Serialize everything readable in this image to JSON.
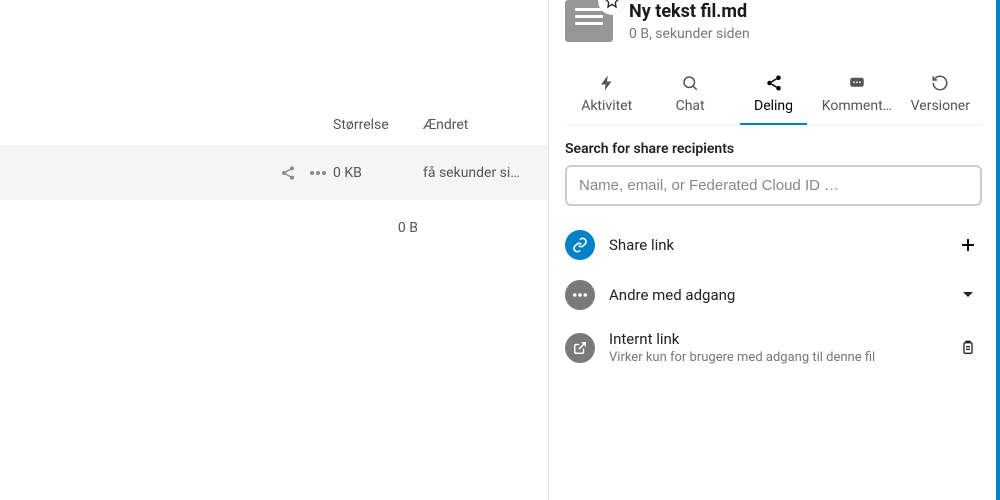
{
  "left": {
    "headers": {
      "size": "Størrelse",
      "modified": "Ændret"
    },
    "row": {
      "size": "0 KB",
      "modified": "få sekunder si…"
    },
    "summary": "0 B"
  },
  "detail": {
    "filename": "Ny tekst fil.md",
    "subtitle": "0 B, sekunder siden"
  },
  "tabs": {
    "activity": "Aktivitet",
    "chat": "Chat",
    "sharing": "Deling",
    "comments": "Komment…",
    "versions": "Versioner"
  },
  "search": {
    "label": "Search for share recipients",
    "placeholder": "Name, email, or Federated Cloud ID …"
  },
  "shares": {
    "link": "Share link",
    "others": "Andre med adgang",
    "internal_title": "Internt link",
    "internal_sub": "Virker kun for brugere med adgang til denne fil"
  }
}
